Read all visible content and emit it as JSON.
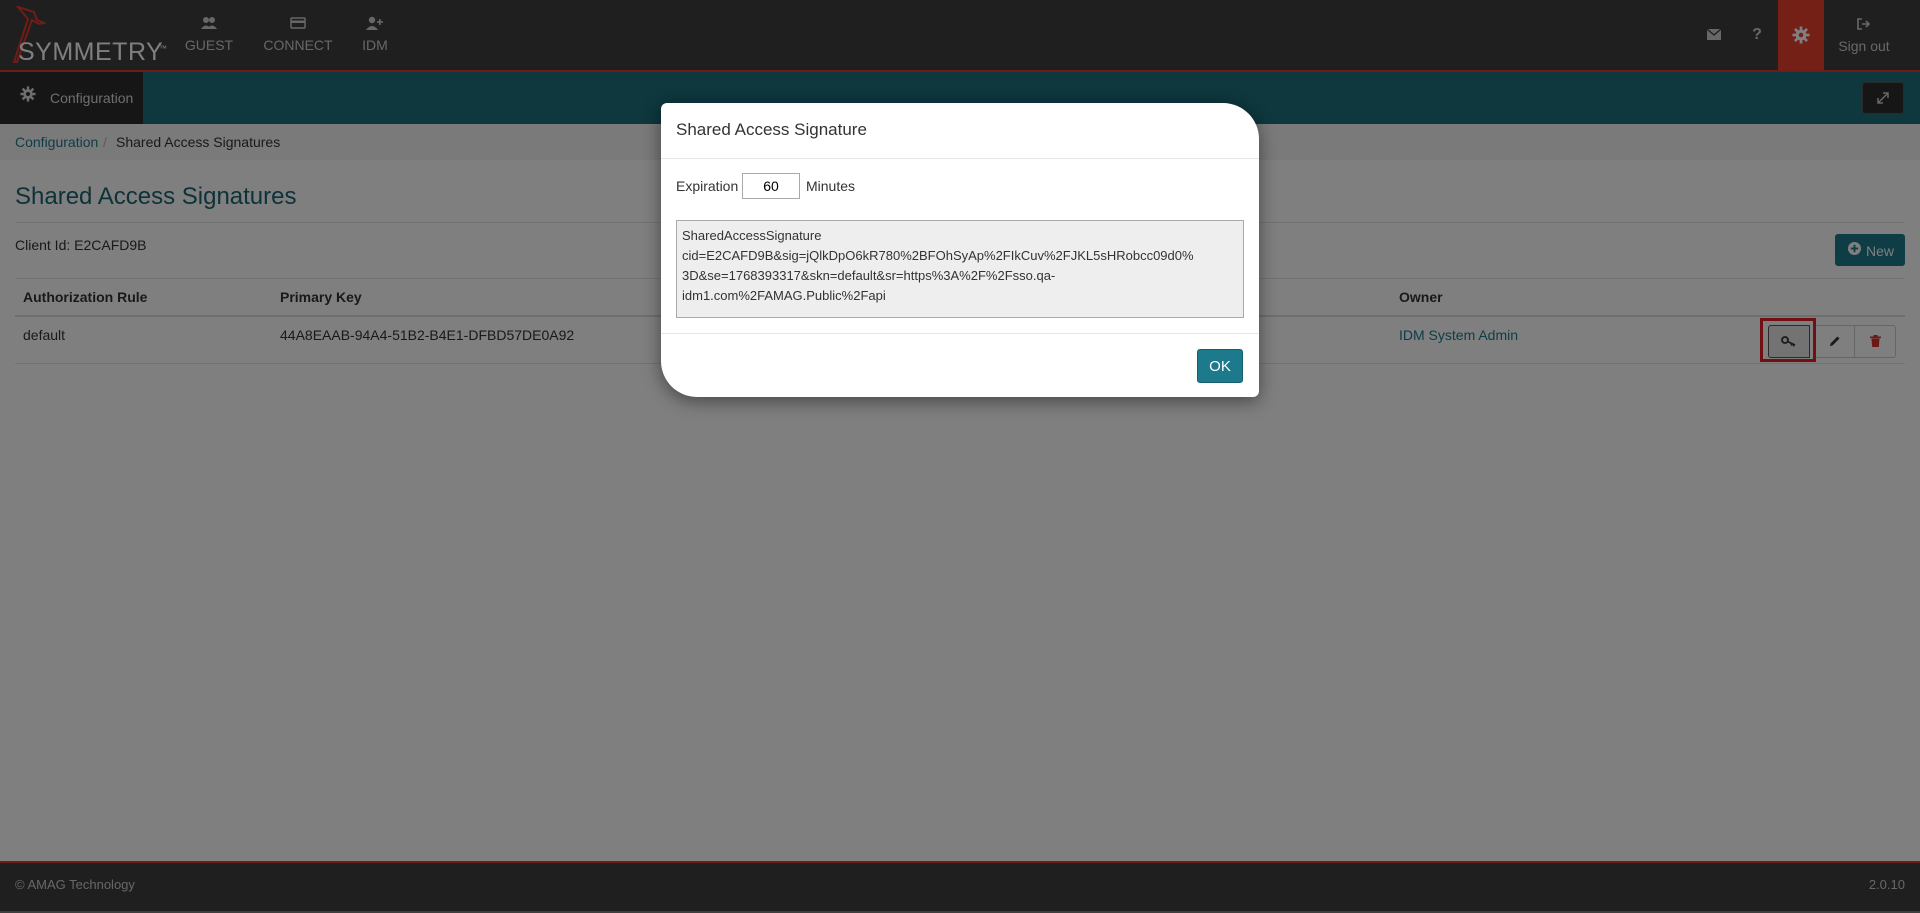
{
  "header": {
    "logo_text": "SYMMETRY",
    "logo_tm": "™",
    "nav": [
      {
        "label": "GUEST",
        "icon": "users-icon"
      },
      {
        "label": "CONNECT",
        "icon": "card-icon"
      },
      {
        "label": "IDM",
        "icon": "user-plus-icon"
      }
    ],
    "help_glyph": "?",
    "sign_out": "Sign out"
  },
  "subheader": {
    "section_label": "Configuration"
  },
  "breadcrumb": {
    "items": [
      "Configuration",
      "Shared Access Signatures"
    ],
    "separator": "/"
  },
  "page": {
    "title": "Shared Access Signatures",
    "client_id": "Client Id: E2CAFD9B",
    "new_button": "New"
  },
  "table": {
    "headers": [
      "Authorization Rule",
      "Primary Key",
      "Owner"
    ],
    "rows": [
      {
        "rule": "default",
        "primary_key": "44A8EAAB-94A4-51B2-B4E1-DFBD57DE0A92",
        "owner": "IDM System Admin"
      }
    ]
  },
  "modal": {
    "title": "Shared Access Signature",
    "expiration_label": "Expiration",
    "expiration_value": "60",
    "expiration_unit": "Minutes",
    "signature_lines": [
      "SharedAccessSignature",
      "cid=E2CAFD9B&sig=jQlkDpO6kR780%2BFOhSyAp%2FIkCuv%2FJKL5sHRobcc09d0%",
      "3D&se=1768393317&skn=default&sr=https%3A%2F%2Fsso.qa-",
      "idm1.com%2FAMAG.Public%2Fapi"
    ],
    "ok_button": "OK"
  },
  "footer": {
    "copyright": "© AMAG Technology",
    "version": "2.0.10"
  },
  "colors": {
    "accent": "#1d7a8c",
    "brand_red": "#e8402f",
    "topbar": "#3f3f3f",
    "highlight": "#e0202a"
  }
}
